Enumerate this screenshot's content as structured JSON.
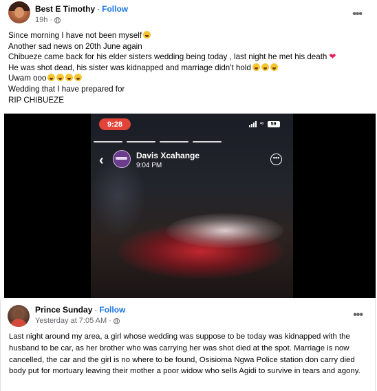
{
  "post": {
    "author": "Best E Timothy",
    "separator": "·",
    "follow_label": "Follow",
    "time": "19h ·",
    "text_lines": [
      "Since morning I have not been myself",
      "Another sad news on 20th June again",
      "Chibueze came back for his elder sisters wedding being today , last night  he met his death",
      "He was shot dead, his sister was kidnapped and marriage didn't hold",
      "Uwam ooo",
      "Wedding that I have prepared for",
      "RIP CHIBUEZE"
    ]
  },
  "video": {
    "status_time": "9:28",
    "battery": "59",
    "story_name": "Davis Xcahange",
    "story_time": "9:04 PM",
    "back_icon": "chevron-left-icon",
    "more_icon": "more-circle-icon"
  },
  "shared": {
    "author": "Prince Sunday",
    "separator": "·",
    "follow_label": "Follow",
    "time": "Yesterday at 7:05 AM ·",
    "text": "Last night around my area, a girl whose wedding was suppose to be today was kidnapped with the husband to be car, as her brother who was carrying her was shot died at the spot. Marriage is now cancelled, the car and the girl is no where to be found, Osisioma Ngwa Police station don carry died body put for mortuary leaving their mother a poor widow who sells Agidi to survive in tears and agony."
  },
  "colors": {
    "link": "#1b74e4",
    "meta": "#65676b",
    "time_pill": "#e2443a"
  }
}
